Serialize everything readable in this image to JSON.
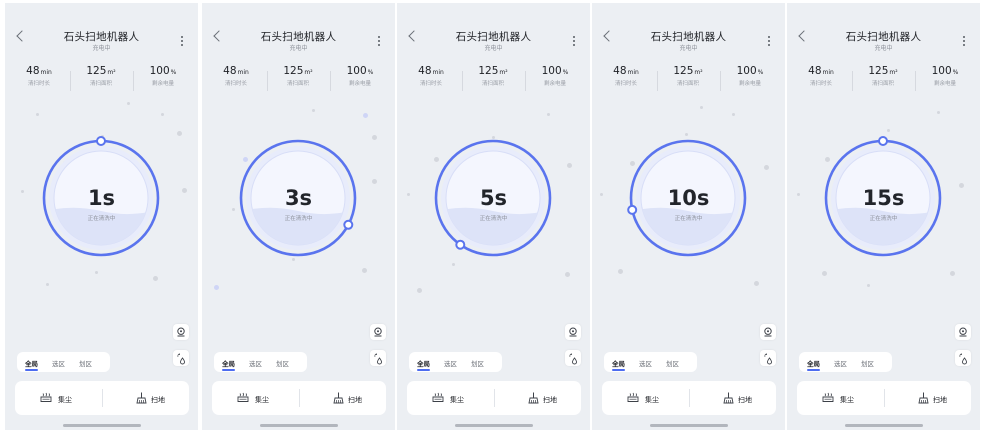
{
  "app": {
    "title": "石头扫地机器人",
    "subtitle": "充电中",
    "back_icon": "chevron-left-icon",
    "more_icon": "more-vertical-icon"
  },
  "stats": [
    {
      "value": "48",
      "unit": "min",
      "label": "清扫时长"
    },
    {
      "value": "125",
      "unit": "m²",
      "label": "清扫面积"
    },
    {
      "value": "100",
      "unit": "%",
      "label": "剩余电量"
    }
  ],
  "status_text": "正在清洗中",
  "screens": [
    {
      "time": "1s",
      "progress_handle_angle_deg": 0
    },
    {
      "time": "3s",
      "progress_handle_angle_deg": 118
    },
    {
      "time": "5s",
      "progress_handle_angle_deg": 215
    },
    {
      "time": "10s",
      "progress_handle_angle_deg": 258
    },
    {
      "time": "15s",
      "progress_handle_angle_deg": 0
    }
  ],
  "tabs": [
    "全局",
    "选区",
    "划区"
  ],
  "active_tab": "全局",
  "actions": [
    {
      "label": "集尘",
      "icon": "dust-collect-icon"
    },
    {
      "label": "扫地",
      "icon": "sweep-broom-icon"
    }
  ],
  "side_buttons": [
    "robot-locate-icon",
    "water-spray-icon"
  ],
  "colors": {
    "accent": "#5a74ee",
    "background": "#eceff3",
    "water_fill": "#dde3f8",
    "inner_disc": "#f4f6fe"
  }
}
